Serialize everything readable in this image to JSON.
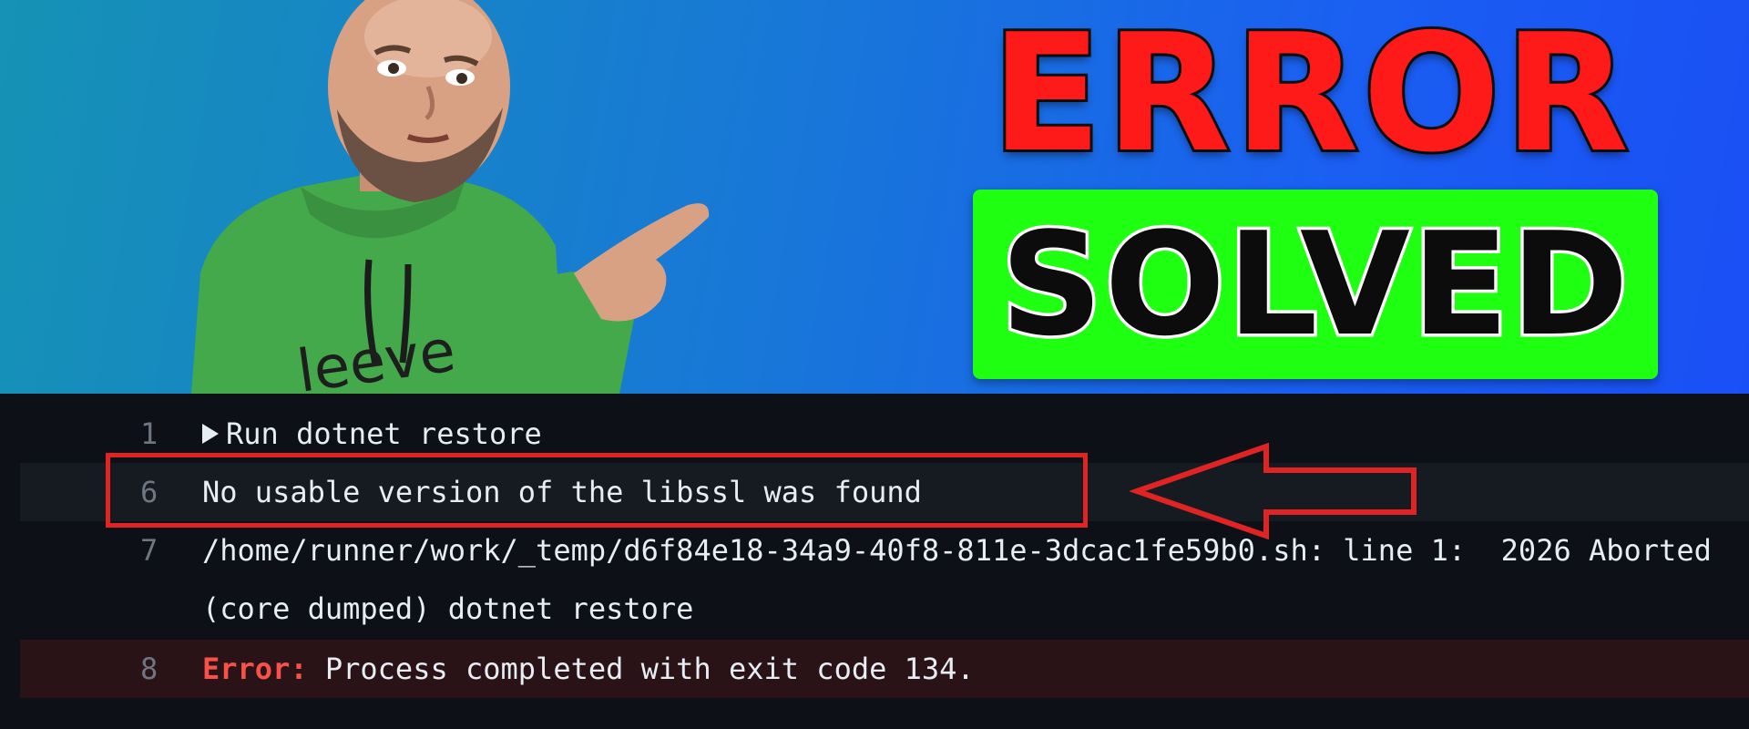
{
  "banner": {
    "title_error": "ERROR",
    "title_solved": "SOLVED",
    "colors": {
      "error_text": "#ff1a1a",
      "solved_background": "#1fff12",
      "solved_text": "#0c0c0c",
      "background_start": "#1592b5",
      "background_end": "#1a4ff5"
    }
  },
  "log": {
    "lines": [
      {
        "number": "1",
        "text": "Run dotnet restore",
        "collapsed_icon": "triangle-right-icon"
      },
      {
        "number": "6",
        "text": "No usable version of the libssl was found"
      },
      {
        "number": "7",
        "text": "/home/runner/work/_temp/d6f84e18-34a9-40f8-811e-3dcac1fe59b0.sh: line 1:  2026 Aborted"
      },
      {
        "number": "",
        "text": "(core dumped) dotnet restore"
      },
      {
        "number": "8",
        "label": "Error:",
        "text": " Process completed with exit code 134."
      }
    ],
    "colors": {
      "background": "#0d1117",
      "highlight": "#e02424",
      "error_label": "#f85149",
      "error_row": "#2a1316"
    }
  }
}
